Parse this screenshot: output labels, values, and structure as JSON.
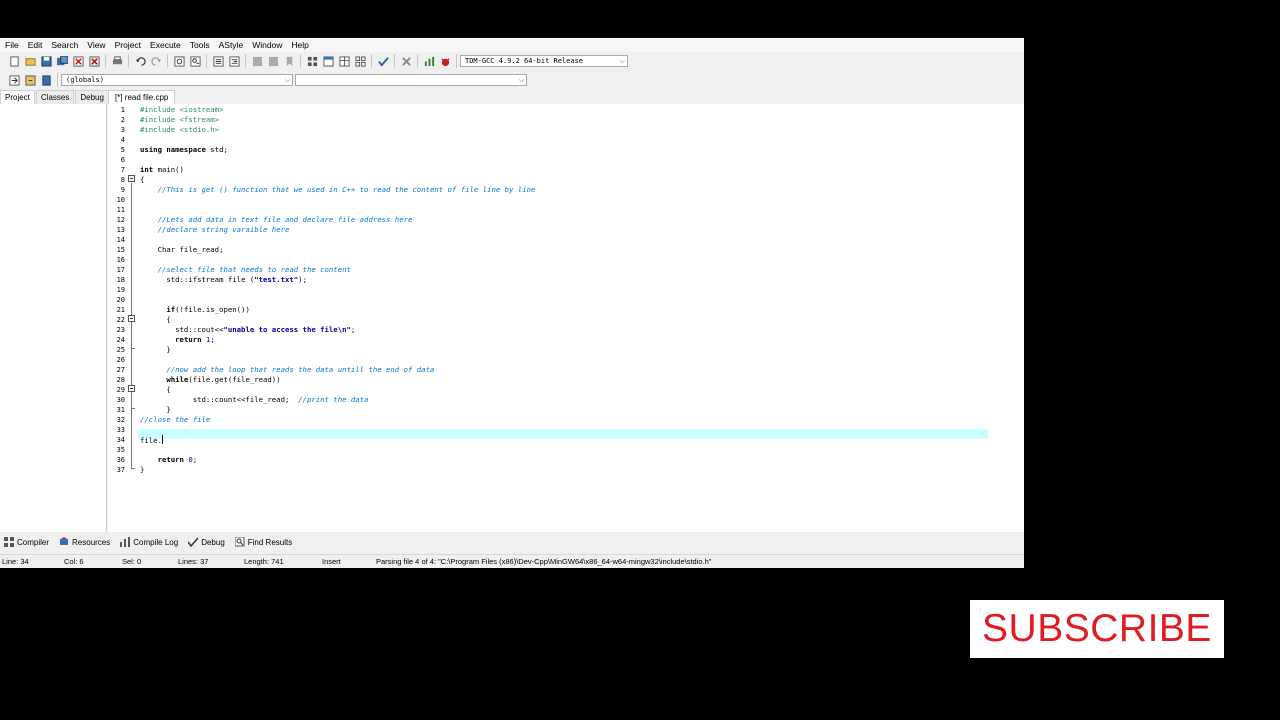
{
  "menu": [
    "File",
    "Edit",
    "Search",
    "View",
    "Project",
    "Execute",
    "Tools",
    "AStyle",
    "Window",
    "Help"
  ],
  "toolbar": {
    "compiler_select": "TDM-GCC 4.9.2 64-bit Release",
    "scope_select": "(globals)",
    "function_select": "",
    "icons": [
      "new-file-icon",
      "open-icon",
      "save-icon",
      "save-all-icon",
      "close-icon",
      "close-all-icon",
      "print-icon",
      "undo-icon",
      "redo-icon",
      "find-icon",
      "replace-icon",
      "indent-icon",
      "unindent-icon",
      "back-icon",
      "forward-icon",
      "bookmark-icon",
      "compile-icon",
      "run-icon",
      "compile-run-icon",
      "rebuild-icon",
      "check-icon",
      "stop-icon",
      "chart-icon",
      "debug-icon"
    ]
  },
  "left_panel": {
    "tabs": [
      "Project",
      "Classes",
      "Debug"
    ]
  },
  "editor": {
    "tab_label": "[*] read file.cpp",
    "lines": [
      [
        [
          "pp",
          "#include <iostream>"
        ]
      ],
      [
        [
          "pp",
          "#include <fstream>"
        ]
      ],
      [
        [
          "pp",
          "#include <stdio.h>"
        ]
      ],
      [],
      [
        [
          "kw",
          "using namespace"
        ],
        [
          "t",
          " std;"
        ]
      ],
      [],
      [
        [
          "kw",
          "int"
        ],
        [
          "t",
          " main()"
        ]
      ],
      [
        [
          "t",
          "{"
        ]
      ],
      [
        [
          "t",
          "    "
        ],
        [
          "cm",
          "//This is get () function that we used in C++ to read the content of file line by line"
        ]
      ],
      [],
      [],
      [
        [
          "t",
          "    "
        ],
        [
          "cm",
          "//Lets add data in text file and declare file address here"
        ]
      ],
      [
        [
          "t",
          "    "
        ],
        [
          "cm",
          "//declare string varaible here"
        ]
      ],
      [],
      [
        [
          "t",
          "    Char file_read;"
        ]
      ],
      [],
      [
        [
          "t",
          "    "
        ],
        [
          "cm",
          "//select file that needs to read the content"
        ]
      ],
      [
        [
          "t",
          "      std::ifstream file ("
        ],
        [
          "str",
          "\"test.txt\""
        ],
        [
          "t",
          ");"
        ]
      ],
      [],
      [],
      [
        [
          "t",
          "      "
        ],
        [
          "kw",
          "if"
        ],
        [
          "t",
          "(!file.is_open())"
        ]
      ],
      [
        [
          "t",
          "      {"
        ]
      ],
      [
        [
          "t",
          "        std::cout<<"
        ],
        [
          "str",
          "\"unable to access the file\\n\""
        ],
        [
          "t",
          ";"
        ]
      ],
      [
        [
          "t",
          "        "
        ],
        [
          "kw",
          "return"
        ],
        [
          "t",
          " "
        ],
        [
          "num",
          "1"
        ],
        [
          "t",
          ";"
        ]
      ],
      [
        [
          "t",
          "      }"
        ]
      ],
      [],
      [
        [
          "t",
          "      "
        ],
        [
          "cm",
          "//now add the loop that reads the data untill the end of data"
        ]
      ],
      [
        [
          "t",
          "      "
        ],
        [
          "kw",
          "while"
        ],
        [
          "t",
          "(file.get(file_read))"
        ]
      ],
      [
        [
          "t",
          "      {"
        ]
      ],
      [
        [
          "t",
          "            std::count<<file_read;  "
        ],
        [
          "cm",
          "//print the data"
        ]
      ],
      [
        [
          "t",
          "      }"
        ]
      ],
      [
        [
          "cm",
          "//close the file"
        ]
      ],
      [],
      [
        [
          "t",
          "file."
        ]
      ],
      [],
      [
        [
          "t",
          "    "
        ],
        [
          "kw",
          "return"
        ],
        [
          "t",
          " "
        ],
        [
          "num",
          "0"
        ],
        [
          "t",
          ";"
        ]
      ],
      [
        [
          "t",
          "}"
        ]
      ]
    ],
    "current_line": 34,
    "fold_markers": [
      8,
      22,
      29
    ],
    "line_numbers": [
      "1",
      "2",
      "3",
      "4",
      "5",
      "6",
      "7",
      "8",
      "9",
      "10",
      "11",
      "12",
      "13",
      "14",
      "15",
      "16",
      "17",
      "18",
      "19",
      "20",
      "21",
      "22",
      "23",
      "24",
      "25",
      "26",
      "27",
      "28",
      "29",
      "30",
      "31",
      "32",
      "33",
      "34",
      "35",
      "36",
      "37"
    ]
  },
  "bottom_tabs": [
    {
      "label": "Compiler",
      "icon": "compiler-grid-icon"
    },
    {
      "label": "Resources",
      "icon": "resources-icon"
    },
    {
      "label": "Compile Log",
      "icon": "compile-log-chart-icon"
    },
    {
      "label": "Debug",
      "icon": "debug-check-icon"
    },
    {
      "label": "Find Results",
      "icon": "find-results-icon"
    }
  ],
  "status": {
    "line": "Line:   34",
    "col": "Col:   6",
    "sel": "Sel:   0",
    "lines": "Lines:   37",
    "length": "Length:   741",
    "mode": "Insert",
    "message": "Parsing file 4 of 4: \"C:\\Program Files (x86)\\Dev-Cpp\\MinGW64\\x86_64-w64-mingw32\\include\\stdio.h\""
  },
  "overlay": {
    "subscribe": "SUBSCRIBE"
  },
  "colors": {
    "comment": "#0078d7",
    "preprocessor": "#2e8b57",
    "string": "#0000a0",
    "current_line": "#ccffff",
    "subscribe_red": "#e11b22"
  }
}
